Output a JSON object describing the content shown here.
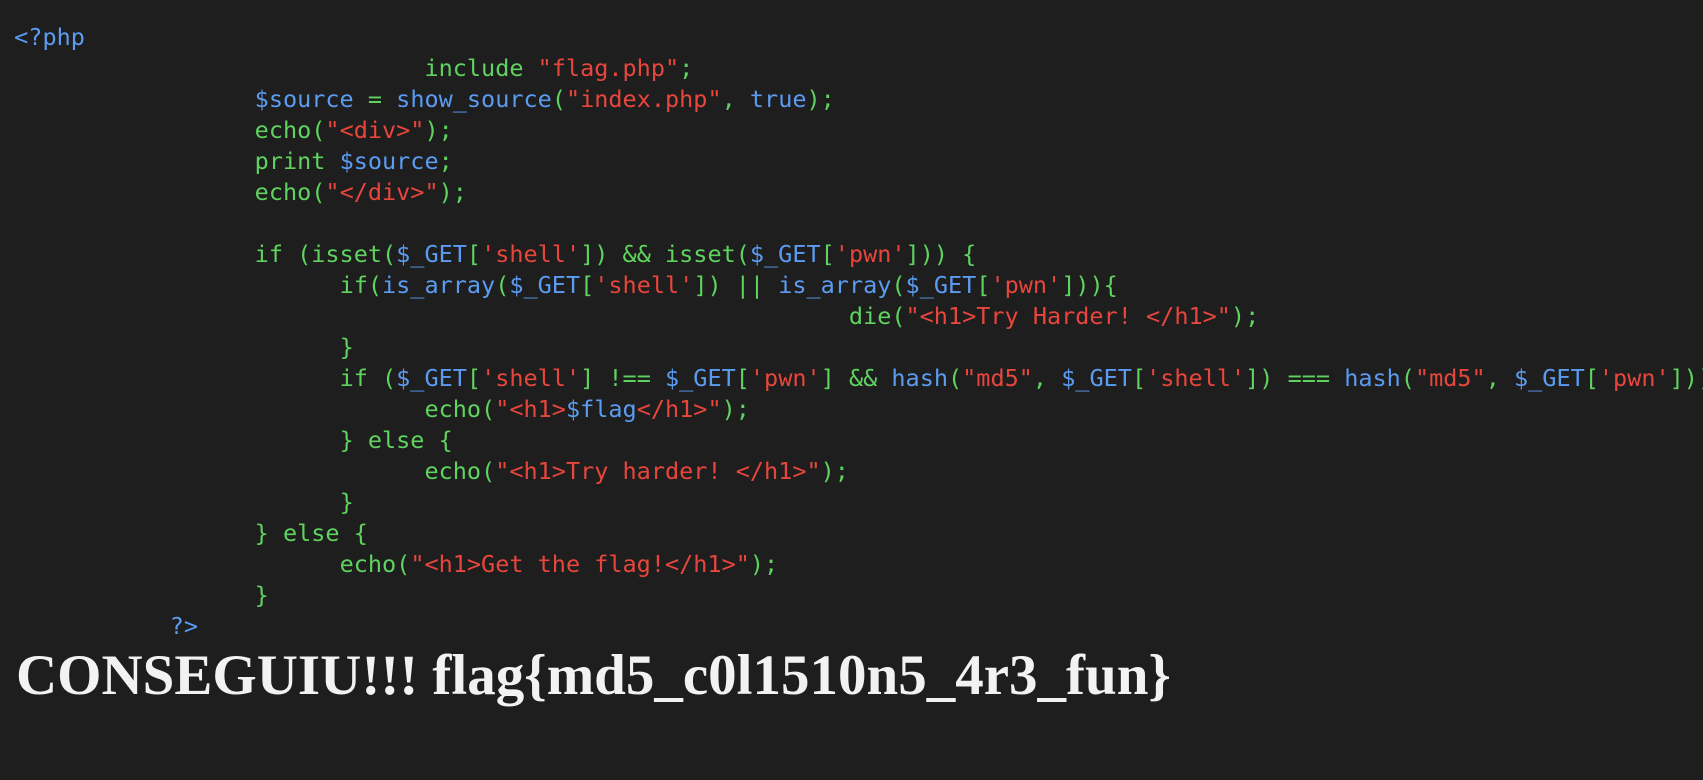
{
  "colors": {
    "background": "#1e1e1e",
    "default": "#5fd35f",
    "keyword": "#5fd35f",
    "variable": "#5b9cf2",
    "string": "#e8463c",
    "heading": "#f2f2f2"
  },
  "source_lines": [
    {
      "indent": 1,
      "tokens": [
        {
          "t": "<?php",
          "c": "variable"
        }
      ]
    },
    {
      "indent": 30,
      "tokens": [
        {
          "t": "include ",
          "c": "default"
        },
        {
          "t": "\"flag.php\"",
          "c": "string"
        },
        {
          "t": ";",
          "c": "default"
        }
      ]
    },
    {
      "indent": 18,
      "tokens": [
        {
          "t": "$source",
          "c": "variable"
        },
        {
          "t": " = ",
          "c": "default"
        },
        {
          "t": "show_source",
          "c": "variable"
        },
        {
          "t": "(",
          "c": "default"
        },
        {
          "t": "\"index.php\"",
          "c": "string"
        },
        {
          "t": ", ",
          "c": "default"
        },
        {
          "t": "true",
          "c": "variable"
        },
        {
          "t": ");",
          "c": "default"
        }
      ]
    },
    {
      "indent": 18,
      "tokens": [
        {
          "t": "echo(",
          "c": "default"
        },
        {
          "t": "\"<div>\"",
          "c": "string"
        },
        {
          "t": ");",
          "c": "default"
        }
      ]
    },
    {
      "indent": 18,
      "tokens": [
        {
          "t": "print ",
          "c": "default"
        },
        {
          "t": "$source",
          "c": "variable"
        },
        {
          "t": ";",
          "c": "default"
        }
      ]
    },
    {
      "indent": 18,
      "tokens": [
        {
          "t": "echo(",
          "c": "default"
        },
        {
          "t": "\"</div>\"",
          "c": "string"
        },
        {
          "t": ");",
          "c": "default"
        }
      ]
    },
    {
      "indent": 0,
      "tokens": []
    },
    {
      "indent": 18,
      "tokens": [
        {
          "t": "if (isset(",
          "c": "default"
        },
        {
          "t": "$_GET",
          "c": "variable"
        },
        {
          "t": "[",
          "c": "default"
        },
        {
          "t": "'shell'",
          "c": "string"
        },
        {
          "t": "]) && isset(",
          "c": "default"
        },
        {
          "t": "$_GET",
          "c": "variable"
        },
        {
          "t": "[",
          "c": "default"
        },
        {
          "t": "'pwn'",
          "c": "string"
        },
        {
          "t": "])) {",
          "c": "default"
        }
      ]
    },
    {
      "indent": 24,
      "tokens": [
        {
          "t": "if(",
          "c": "default"
        },
        {
          "t": "is_array",
          "c": "variable"
        },
        {
          "t": "(",
          "c": "default"
        },
        {
          "t": "$_GET",
          "c": "variable"
        },
        {
          "t": "[",
          "c": "default"
        },
        {
          "t": "'shell'",
          "c": "string"
        },
        {
          "t": "]) || ",
          "c": "default"
        },
        {
          "t": "is_array",
          "c": "variable"
        },
        {
          "t": "(",
          "c": "default"
        },
        {
          "t": "$_GET",
          "c": "variable"
        },
        {
          "t": "[",
          "c": "default"
        },
        {
          "t": "'pwn'",
          "c": "string"
        },
        {
          "t": "])){",
          "c": "default"
        }
      ]
    },
    {
      "indent": 60,
      "tokens": [
        {
          "t": "die(",
          "c": "default"
        },
        {
          "t": "\"<h1>Try Harder! </h1>\"",
          "c": "string"
        },
        {
          "t": ");",
          "c": "default"
        }
      ]
    },
    {
      "indent": 24,
      "tokens": [
        {
          "t": "}",
          "c": "default"
        }
      ]
    },
    {
      "indent": 24,
      "tokens": [
        {
          "t": "if (",
          "c": "default"
        },
        {
          "t": "$_GET",
          "c": "variable"
        },
        {
          "t": "[",
          "c": "default"
        },
        {
          "t": "'shell'",
          "c": "string"
        },
        {
          "t": "] !== ",
          "c": "default"
        },
        {
          "t": "$_GET",
          "c": "variable"
        },
        {
          "t": "[",
          "c": "default"
        },
        {
          "t": "'pwn'",
          "c": "string"
        },
        {
          "t": "] && ",
          "c": "default"
        },
        {
          "t": "hash",
          "c": "variable"
        },
        {
          "t": "(",
          "c": "default"
        },
        {
          "t": "\"md5\"",
          "c": "string"
        },
        {
          "t": ", ",
          "c": "default"
        },
        {
          "t": "$_GET",
          "c": "variable"
        },
        {
          "t": "[",
          "c": "default"
        },
        {
          "t": "'shell'",
          "c": "string"
        },
        {
          "t": "]) === ",
          "c": "default"
        },
        {
          "t": "hash",
          "c": "variable"
        },
        {
          "t": "(",
          "c": "default"
        },
        {
          "t": "\"md5\"",
          "c": "string"
        },
        {
          "t": ", ",
          "c": "default"
        },
        {
          "t": "$_GET",
          "c": "variable"
        },
        {
          "t": "[",
          "c": "default"
        },
        {
          "t": "'pwn'",
          "c": "string"
        },
        {
          "t": "])) {",
          "c": "default"
        }
      ]
    },
    {
      "indent": 30,
      "tokens": [
        {
          "t": "echo(",
          "c": "default"
        },
        {
          "t": "\"<h1>",
          "c": "string"
        },
        {
          "t": "$flag",
          "c": "variable"
        },
        {
          "t": "</h1>\"",
          "c": "string"
        },
        {
          "t": ");",
          "c": "default"
        }
      ]
    },
    {
      "indent": 24,
      "tokens": [
        {
          "t": "} else {",
          "c": "default"
        }
      ]
    },
    {
      "indent": 30,
      "tokens": [
        {
          "t": "echo(",
          "c": "default"
        },
        {
          "t": "\"<h1>Try harder! </h1>\"",
          "c": "string"
        },
        {
          "t": ");",
          "c": "default"
        }
      ]
    },
    {
      "indent": 24,
      "tokens": [
        {
          "t": "}",
          "c": "default"
        }
      ]
    },
    {
      "indent": 18,
      "tokens": [
        {
          "t": "} else {",
          "c": "default"
        }
      ]
    },
    {
      "indent": 24,
      "tokens": [
        {
          "t": "echo(",
          "c": "default"
        },
        {
          "t": "\"<h1>Get the flag!</h1>\"",
          "c": "string"
        },
        {
          "t": ");",
          "c": "default"
        }
      ]
    },
    {
      "indent": 18,
      "tokens": [
        {
          "t": "}",
          "c": "default"
        }
      ]
    },
    {
      "indent": 12,
      "tokens": [
        {
          "t": "?>",
          "c": "variable"
        }
      ]
    }
  ],
  "result_heading": "CONSEGUIU!!! flag{md5_c0l1510n5_4r3_fun}"
}
